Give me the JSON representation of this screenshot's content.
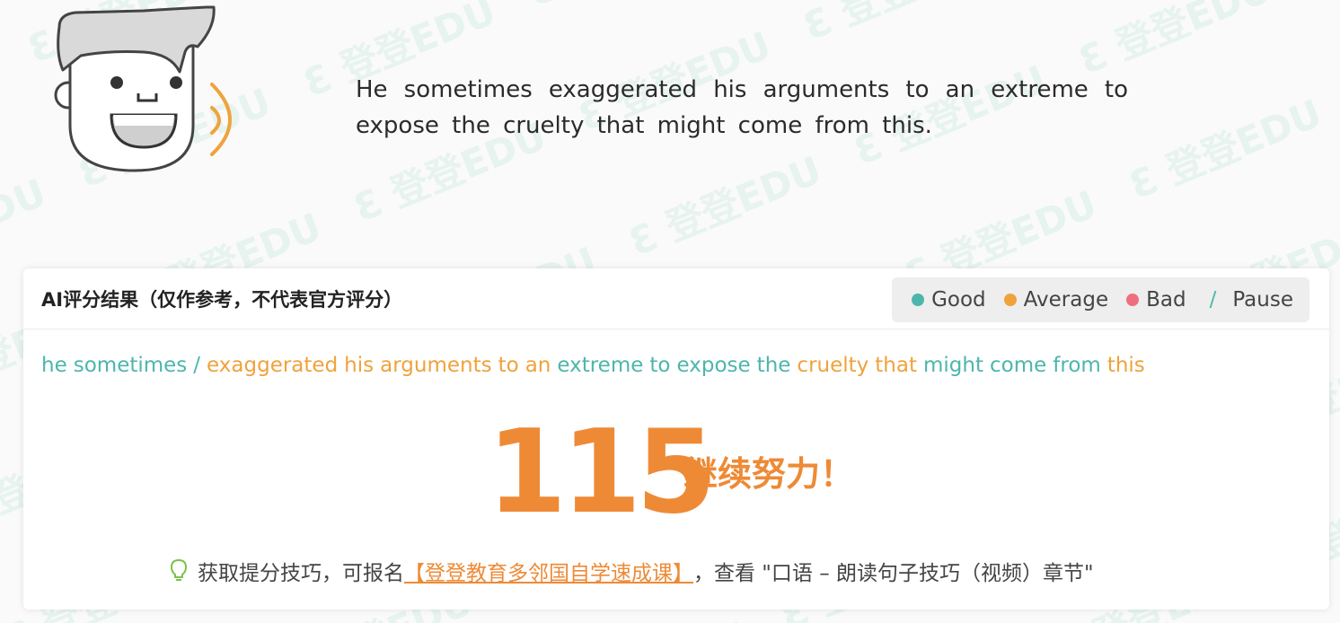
{
  "prompt": {
    "sentence": "He sometimes exaggerated his arguments to an extreme to expose the cruelty that might come from this."
  },
  "result": {
    "title": "AI评分结果（仅作参考，不代表官方评分）",
    "legend": {
      "good": "Good",
      "average": "Average",
      "bad": "Bad",
      "pause_symbol": "/",
      "pause": "Pause"
    },
    "colors": {
      "good": "#4db6ac",
      "average": "#f0a23b",
      "bad": "#ef6f7e",
      "score": "#ee8a36"
    },
    "words": [
      {
        "text": "he",
        "grade": "good"
      },
      {
        "text": "sometimes",
        "grade": "good"
      },
      {
        "text": "/",
        "grade": "pause"
      },
      {
        "text": "exaggerated",
        "grade": "average"
      },
      {
        "text": "his",
        "grade": "average"
      },
      {
        "text": "arguments",
        "grade": "average"
      },
      {
        "text": "to",
        "grade": "average"
      },
      {
        "text": "an",
        "grade": "average"
      },
      {
        "text": "extreme",
        "grade": "good"
      },
      {
        "text": "to",
        "grade": "good"
      },
      {
        "text": "expose",
        "grade": "good"
      },
      {
        "text": "the",
        "grade": "good"
      },
      {
        "text": "cruelty",
        "grade": "average"
      },
      {
        "text": "that",
        "grade": "average"
      },
      {
        "text": "might",
        "grade": "good"
      },
      {
        "text": "come",
        "grade": "good"
      },
      {
        "text": "from",
        "grade": "good"
      },
      {
        "text": "this",
        "grade": "average"
      }
    ],
    "score": "115",
    "encouragement": "继续努力！",
    "tip": {
      "prefix": "获取提分技巧，可报名",
      "link": "【登登教育多邻国自学速成课】",
      "suffix": "，查看 \"口语 – 朗读句子技巧（视频）章节\""
    }
  },
  "watermark": "登登EDU"
}
